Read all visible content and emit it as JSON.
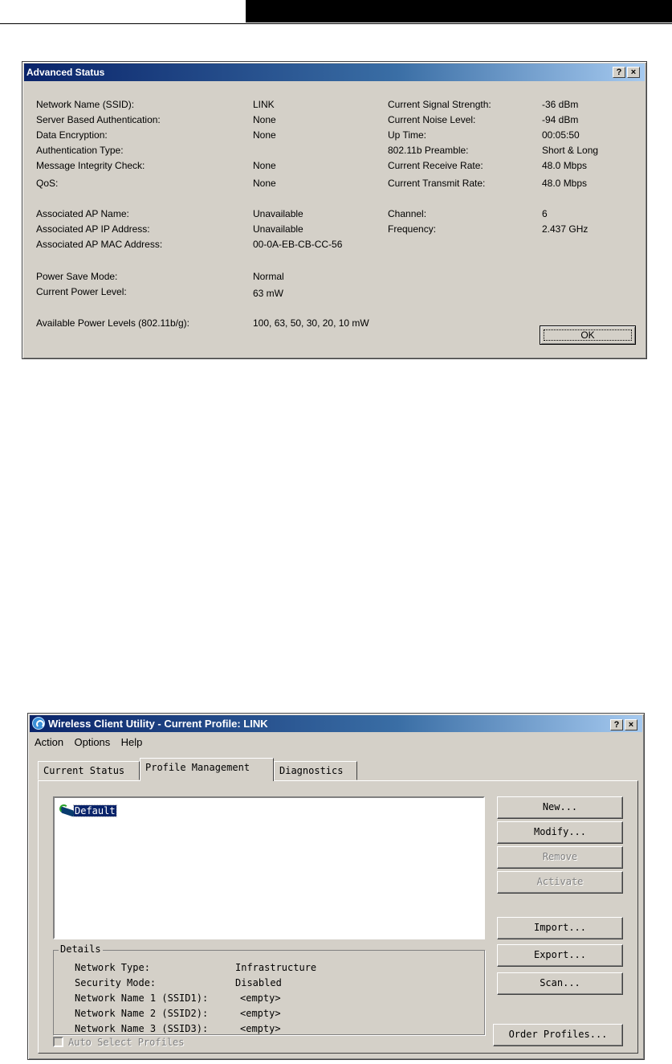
{
  "advanced_status": {
    "title": "Advanced Status",
    "help_glyph": "?",
    "close_glyph": "×",
    "left_labels": [
      "Network Name (SSID):",
      "Server Based Authentication:",
      "Data Encryption:",
      "Authentication Type:",
      "Message Integrity Check:",
      "QoS:",
      "Associated AP Name:",
      "Associated AP IP Address:",
      "Associated AP MAC Address:",
      "Power Save Mode:",
      "Current Power Level:",
      "Available Power Levels (802.11b/g):"
    ],
    "left_values": [
      "LINK",
      "None",
      "None",
      "",
      "None",
      "None",
      "Unavailable",
      "Unavailable",
      "00-0A-EB-CB-CC-56",
      "Normal",
      "63 mW",
      "100, 63, 50, 30, 20, 10 mW"
    ],
    "right_labels": [
      "Current Signal Strength:",
      "Current Noise Level:",
      "Up Time:",
      "802.11b Preamble:",
      "Current Receive Rate:",
      "Current Transmit Rate:",
      "Channel:",
      "Frequency:"
    ],
    "right_values": [
      "-36 dBm",
      "-94 dBm",
      "00:05:50",
      "Short & Long",
      "48.0 Mbps",
      "48.0 Mbps",
      "6",
      "2.437 GHz"
    ],
    "ok_label": "OK"
  },
  "wireless_utility": {
    "title": "Wireless Client Utility - Current Profile: LINK",
    "help_glyph": "?",
    "close_glyph": "×",
    "menu": [
      "Action",
      "Options",
      "Help"
    ],
    "tabs": [
      "Current Status",
      "Profile Management",
      "Diagnostics"
    ],
    "active_tab": "Profile Management",
    "profiles": [
      "Default"
    ],
    "details": {
      "legend": "Details",
      "labels": [
        "Network Type:",
        "Security Mode:",
        "Network Name 1 (SSID1):",
        "Network Name 2 (SSID2):",
        "Network Name 3 (SSID3):"
      ],
      "values": [
        "Infrastructure",
        "Disabled",
        "<empty>",
        "<empty>",
        "<empty>"
      ]
    },
    "buttons": {
      "new": "New...",
      "modify": "Modify...",
      "remove": "Remove",
      "activate": "Activate",
      "import": "Import...",
      "export": "Export...",
      "scan": "Scan...",
      "order_profiles": "Order Profiles..."
    },
    "auto_select_label": "Auto Select Profiles",
    "auto_select_checked": false
  }
}
